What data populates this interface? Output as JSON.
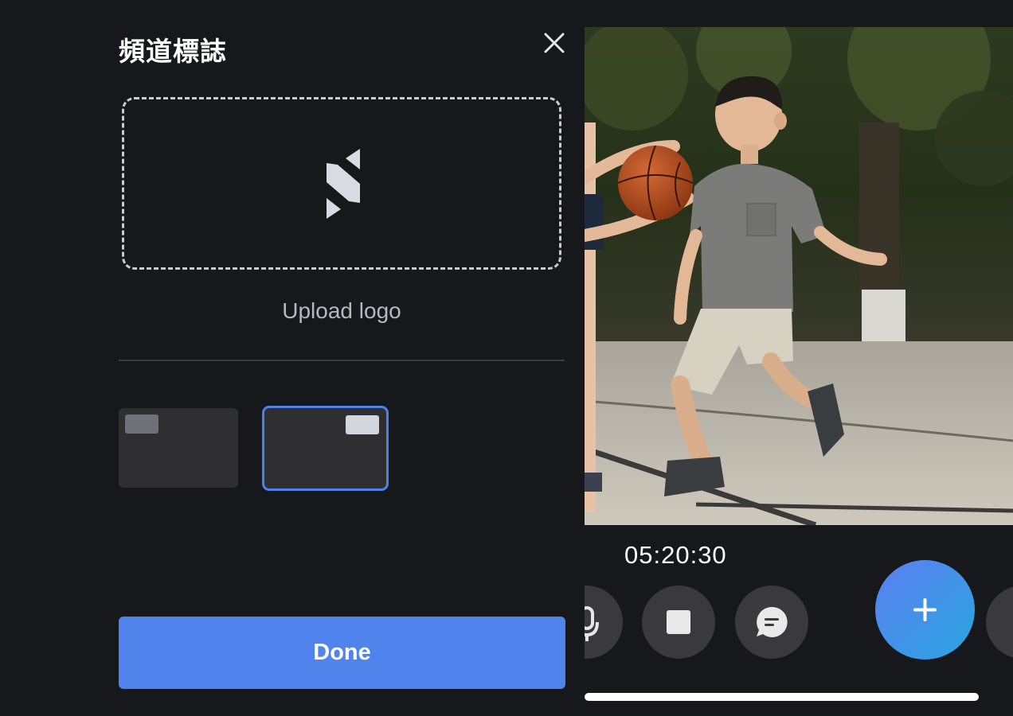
{
  "dialog": {
    "title": "頻道標誌",
    "close_icon": "close-icon",
    "upload_label": "Upload logo",
    "logo_icon": "logo-placeholder-icon",
    "positions": [
      {
        "id": "top-left",
        "selected": false
      },
      {
        "id": "top-right",
        "selected": true
      }
    ],
    "done_label": "Done"
  },
  "player": {
    "timer": "05:20:30",
    "controls": [
      {
        "icon": "microphone-icon"
      },
      {
        "icon": "stop-icon"
      },
      {
        "icon": "chat-icon"
      },
      {
        "icon": "plus-icon"
      }
    ],
    "progress": 0.92
  },
  "colors": {
    "background": "#17181c",
    "accent": "#5083ec",
    "selected_border": "#4f81ea",
    "control_bg": "#3a3a3c"
  }
}
